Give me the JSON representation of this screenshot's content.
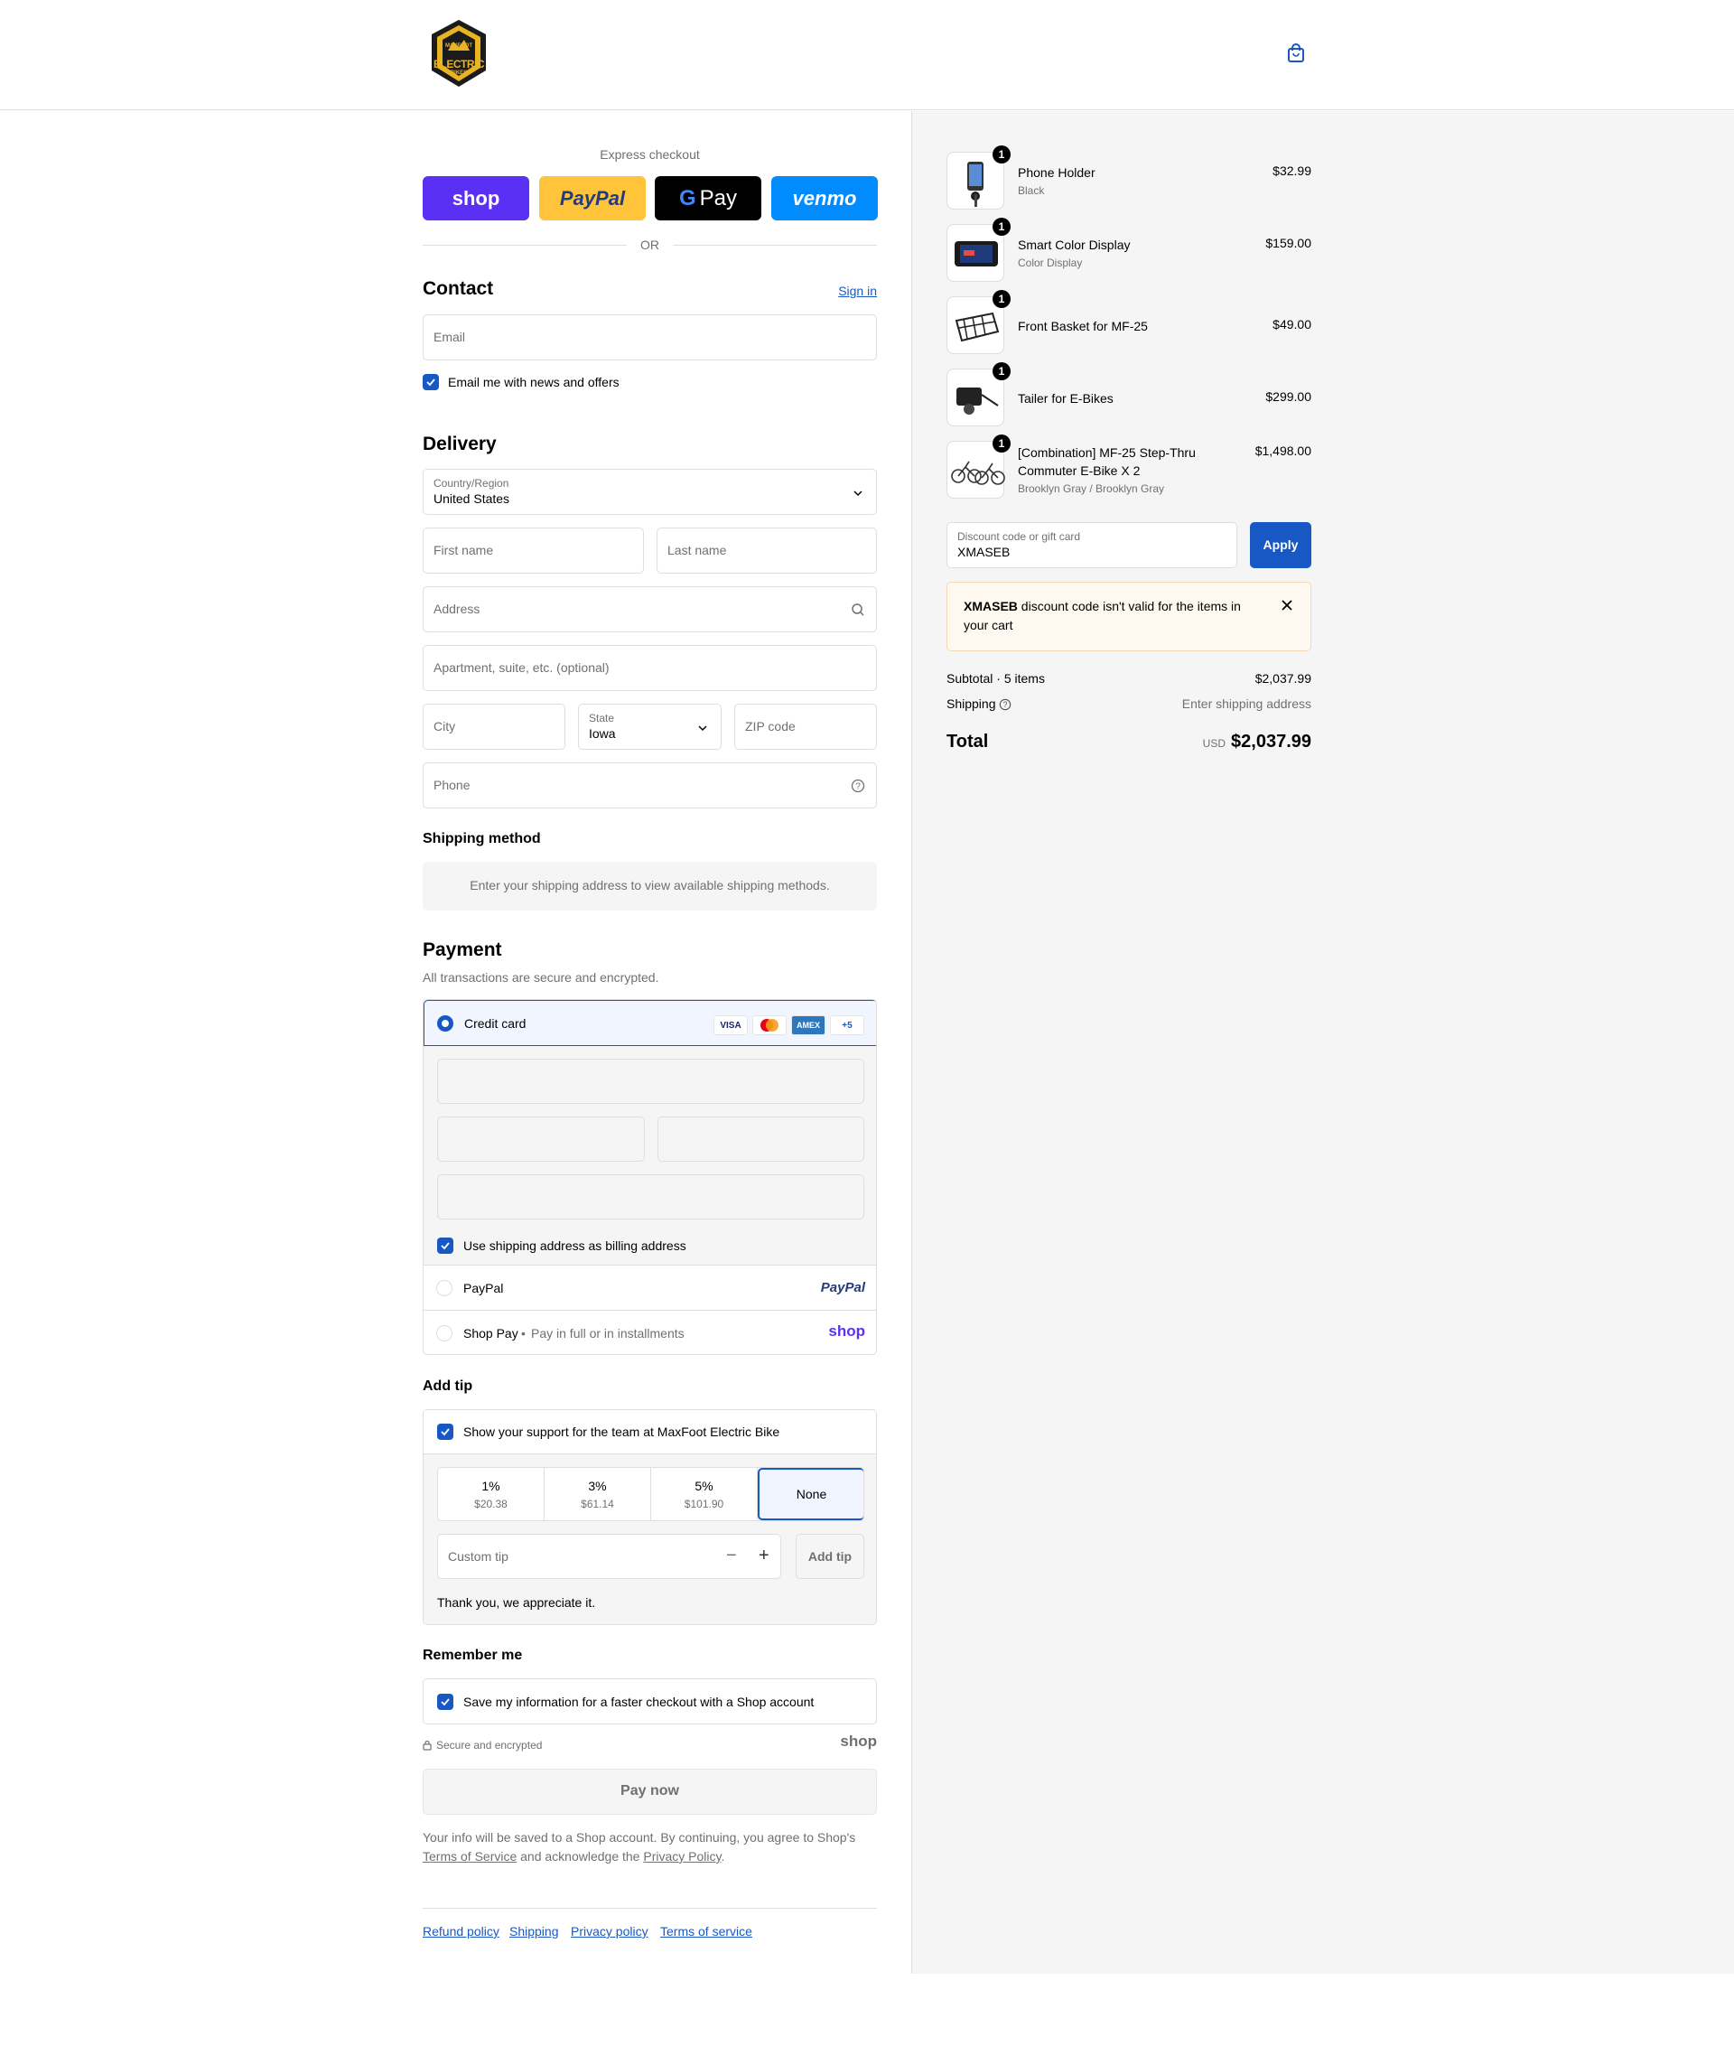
{
  "header": {
    "logo_top": "MAXFOOT",
    "logo_mid": "ELECTRIC",
    "logo_bot": "BIKES",
    "cart_icon": "shopping-bag-icon"
  },
  "express": {
    "title": "Express checkout",
    "shop_label": "shop",
    "paypal_label": "PayPal",
    "gpay_label": "Pay",
    "venmo_label": "venmo",
    "or": "OR"
  },
  "contact": {
    "title": "Contact",
    "sign_in": "Sign in",
    "email_placeholder": "Email",
    "news_label": "Email me with news and offers"
  },
  "delivery": {
    "title": "Delivery",
    "country_label": "Country/Region",
    "country_value": "United States",
    "first_name": "First name",
    "last_name": "Last name",
    "address": "Address",
    "apartment": "Apartment, suite, etc. (optional)",
    "city": "City",
    "state_label": "State",
    "state_value": "Iowa",
    "zip": "ZIP code",
    "phone": "Phone"
  },
  "shipping_method": {
    "title": "Shipping method",
    "notice": "Enter your shipping address to view available shipping methods."
  },
  "payment": {
    "title": "Payment",
    "subtitle": "All transactions are secure and encrypted.",
    "credit_card": "Credit card",
    "card_visa": "VISA",
    "card_amex": "AMEX",
    "card_more": "+5",
    "billing_label": "Use shipping address as billing address",
    "paypal": "PayPal",
    "paypal_logo": "PayPal",
    "shop_pay": "Shop Pay",
    "shop_pay_sub": "Pay in full or in installments",
    "shop_logo": "shop"
  },
  "tip": {
    "title": "Add tip",
    "support_label": "Show your support for the team at MaxFoot Electric Bike",
    "options": [
      {
        "pct": "1%",
        "amount": "$20.38"
      },
      {
        "pct": "3%",
        "amount": "$61.14"
      },
      {
        "pct": "5%",
        "amount": "$101.90"
      },
      {
        "pct": "None",
        "amount": ""
      }
    ],
    "custom_placeholder": "Custom tip",
    "add_button": "Add tip",
    "thanks": "Thank you, we appreciate it."
  },
  "remember": {
    "title": "Remember me",
    "save_label": "Save my information for a faster checkout with a Shop account",
    "secure": "Secure and encrypted",
    "shop_logo": "shop"
  },
  "pay_now": "Pay now",
  "legal": {
    "line1": "Your info will be saved to a Shop account. By continuing, you agree to Shop's",
    "tos": "Terms of Service",
    "mid": "and acknowledge the",
    "privacy": "Privacy Policy",
    "end": "."
  },
  "footer_links": [
    "Refund policy",
    "Shipping",
    "Privacy policy",
    "Terms of service"
  ],
  "cart": {
    "items": [
      {
        "name": "Phone Holder",
        "variant": "Black",
        "price": "$32.99",
        "qty": "1"
      },
      {
        "name": "Smart Color Display",
        "variant": "Color Display",
        "price": "$159.00",
        "qty": "1"
      },
      {
        "name": "Front Basket for MF-25",
        "variant": "",
        "price": "$49.00",
        "qty": "1"
      },
      {
        "name": "Tailer for E-Bikes",
        "variant": "",
        "price": "$299.00",
        "qty": "1"
      },
      {
        "name": "[Combination] MF-25 Step-Thru Commuter E-Bike X 2",
        "variant": "Brooklyn Gray / Brooklyn Gray",
        "price": "$1,498.00",
        "qty": "1"
      }
    ],
    "discount_label": "Discount code or gift card",
    "discount_value": "XMASEB",
    "apply": "Apply",
    "error_code": "XMASEB",
    "error_text": "discount code isn't valid for the items in your cart",
    "subtotal_label": "Subtotal · 5 items",
    "subtotal_value": "$2,037.99",
    "shipping_label": "Shipping",
    "shipping_value": "Enter shipping address",
    "total_label": "Total",
    "currency": "USD",
    "total_value": "$2,037.99"
  },
  "colors": {
    "accent": "#1758c4",
    "shop_purple": "#5a31f4",
    "paypal_yellow": "#ffc439",
    "venmo_blue": "#008cff",
    "error_bg": "#fff8f0"
  }
}
